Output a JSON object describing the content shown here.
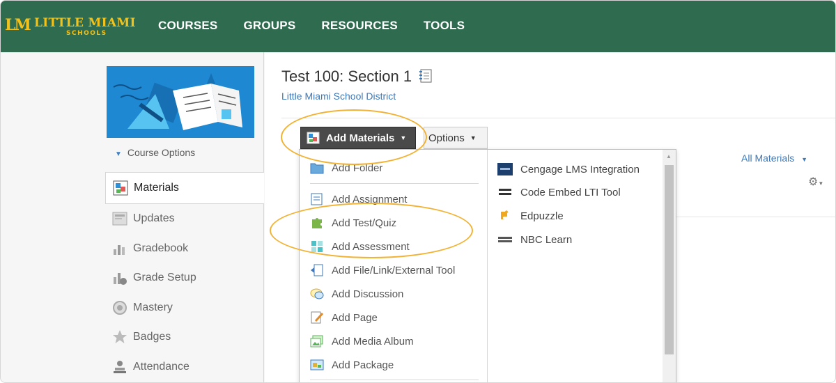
{
  "brand": {
    "name": "LITTLE MIAMI",
    "sub": "SCHOOLS",
    "mark": "LM"
  },
  "nav": {
    "items": [
      "COURSES",
      "GROUPS",
      "RESOURCES",
      "TOOLS"
    ]
  },
  "sidebar": {
    "course_options": "Course Options",
    "items": [
      "Materials",
      "Updates",
      "Gradebook",
      "Grade Setup",
      "Mastery",
      "Badges",
      "Attendance"
    ]
  },
  "main": {
    "title": "Test 100: Section 1",
    "subtitle": "Little Miami School District",
    "add_materials": "Add Materials",
    "options": "Options",
    "all_materials": "All Materials"
  },
  "dropdown": {
    "left_items": [
      "Add Folder",
      "Add Assignment",
      "Add Test/Quiz",
      "Add Assessment",
      "Add File/Link/External Tool",
      "Add Discussion",
      "Add Page",
      "Add Media Album",
      "Add Package"
    ],
    "right_items": [
      "Cengage LMS Integration",
      "Code Embed LTI Tool",
      "Edpuzzle",
      "NBC Learn"
    ]
  },
  "colors": {
    "header": "#2f6b4f",
    "brand_gold": "#f2c21a",
    "link": "#3d78b8",
    "highlight": "#f2b233"
  }
}
